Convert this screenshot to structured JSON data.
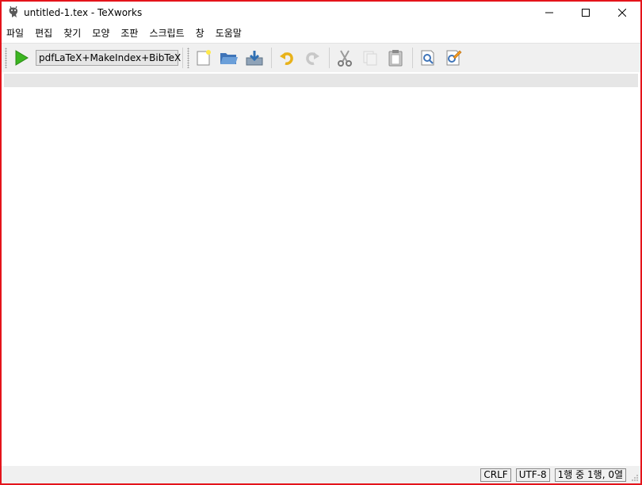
{
  "window": {
    "title": "untitled-1.tex - TeXworks",
    "app_icon": "texworks-lion-icon",
    "controls": [
      "minimize-icon",
      "maximize-icon",
      "close-icon"
    ]
  },
  "menu": {
    "items": [
      "파일",
      "편집",
      "찾기",
      "모양",
      "조판",
      "스크립트",
      "창",
      "도움말"
    ]
  },
  "toolbar": {
    "typeset_icon": "play-triangle-icon",
    "engine": "pdfLaTeX+MakeIndex+BibTeX",
    "buttons": [
      "new-document-icon",
      "open-folder-icon",
      "save-icon",
      "undo-icon",
      "redo-icon",
      "cut-icon",
      "copy-icon",
      "paste-icon",
      "find-icon",
      "replace-icon"
    ]
  },
  "status": {
    "line_ending": "CRLF",
    "encoding": "UTF-8",
    "position": "1행 중 1행, 0열"
  },
  "colors": {
    "frame_border": "#e4141b",
    "play_green": "#3cb521",
    "toolbar_bg": "#f0f0f0"
  }
}
